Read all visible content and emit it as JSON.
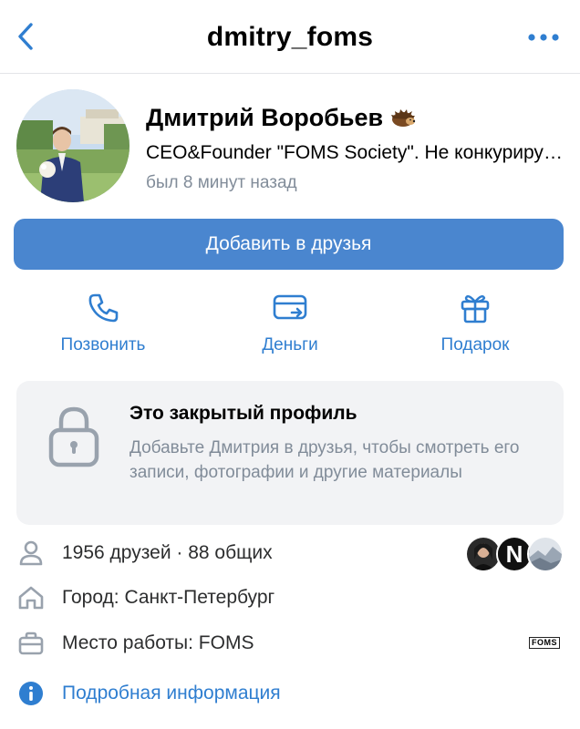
{
  "nav": {
    "title": "dmitry_foms",
    "back_icon": "chevron-left-icon",
    "more_icon": "more-horizontal-icon"
  },
  "profile": {
    "name": "Дмитрий Воробьев",
    "name_emoji": "hedgehog-emoji",
    "status": "CEO&Founder \"FOMS Society\". Не конкурирую, а вдохновляю",
    "last_seen": "был 8 минут назад"
  },
  "add_friend_button": "Добавить в друзья",
  "actions": [
    {
      "label": "Позвонить",
      "icon": "phone-icon"
    },
    {
      "label": "Деньги",
      "icon": "money-transfer-icon"
    },
    {
      "label": "Подарок",
      "icon": "gift-icon"
    }
  ],
  "private_profile": {
    "title": "Это закрытый профиль",
    "description": "Добавьте Дмитрия в друзья, чтобы смотреть его записи, фотографии и другие материалы"
  },
  "info": {
    "friends": "1956 друзей · 88 общих",
    "city": "Город: Санкт-Петербург",
    "work": "Место работы: FOMS",
    "work_logo": "FOMS",
    "details": "Подробная информация"
  },
  "friend_avatar_letter": "N",
  "colors": {
    "accent": "#2f7ed0",
    "button": "#4a86cf",
    "secondary_text": "#818c99",
    "card_bg": "#f2f3f5"
  }
}
